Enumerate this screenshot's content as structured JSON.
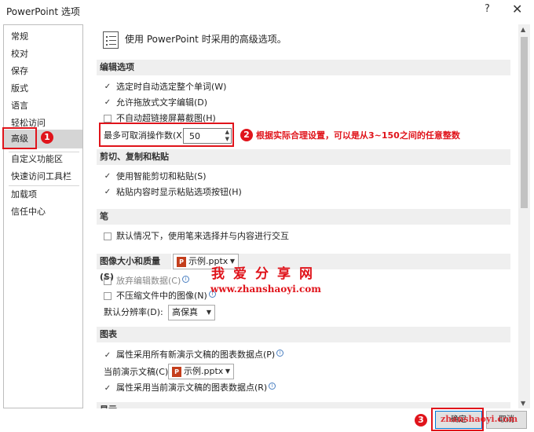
{
  "window": {
    "title": "PowerPoint 选项",
    "help_icon": "?",
    "close_icon": "✕"
  },
  "sidebar": {
    "items": [
      {
        "label": "常规"
      },
      {
        "label": "校对"
      },
      {
        "label": "保存"
      },
      {
        "label": "版式"
      },
      {
        "label": "语言"
      },
      {
        "label": "轻松访问"
      },
      {
        "label": "高级",
        "selected": true
      },
      {
        "label": "自定义功能区"
      },
      {
        "label": "快速访问工具栏"
      },
      {
        "label": "加载项"
      },
      {
        "label": "信任中心"
      }
    ]
  },
  "header": {
    "icon": "options-list-icon",
    "text": "使用 PowerPoint 时采用的高级选项。"
  },
  "sections": {
    "editing": {
      "title": "编辑选项",
      "opt1": "选定时自动选定整个单词(W)",
      "opt2": "允许拖放式文字编辑(D)",
      "opt3": "不自动超链接屏幕截图(H)",
      "undo_label": "最多可取消操作数(X):",
      "undo_value": "50"
    },
    "clipboard": {
      "title": "剪切、复制和粘贴",
      "opt1": "使用智能剪切和粘贴(S)",
      "opt2": "粘贴内容时显示粘贴选项按钮(H)"
    },
    "pen": {
      "title": "笔",
      "opt1": "默认情况下，使用笔来选择并与内容进行交互"
    },
    "image": {
      "title": "图像大小和质量(S)",
      "file": "示例.pptx",
      "opt1": "放弃编辑数据(C)",
      "opt2": "不压缩文件中的图像(N)",
      "res_label": "默认分辨率(D):",
      "res_value": "高保真"
    },
    "chart": {
      "title": "图表",
      "opt1": "属性采用所有新演示文稿的图表数据点(P)",
      "doc_label": "当前演示文稿(C):",
      "file": "示例.pptx",
      "opt2": "属性采用当前演示文稿的图表数据点(R)"
    },
    "display": {
      "title": "显示"
    }
  },
  "annotations": {
    "badge1": "1",
    "badge2": "2",
    "badge3": "3",
    "note2": "根据实际合理设置，可以是从3~150之间的任意整数"
  },
  "watermark": {
    "brand": "我爱分享网",
    "url": "www.zhanshaoyi.com",
    "url_partial": "zhanshaoyi.com"
  },
  "buttons": {
    "ok": "确定",
    "cancel": "取消"
  },
  "colors": {
    "accent_red": "#e0141b",
    "selected_bg": "#d5d5d5",
    "section_bg": "#efefef",
    "ppt_icon": "#c43e1c"
  }
}
